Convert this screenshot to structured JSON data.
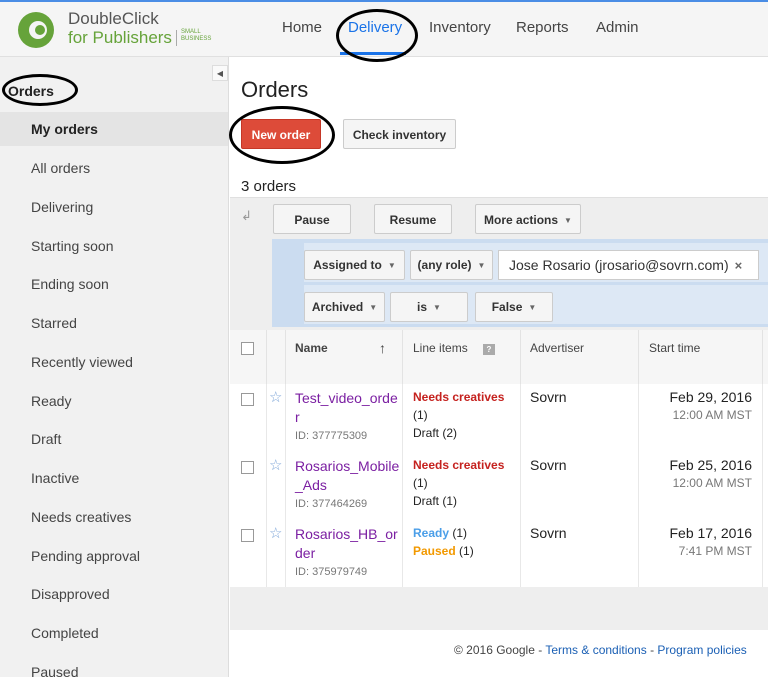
{
  "brand": {
    "line1": "DoubleClick",
    "line2": "for Publishers",
    "tag": "SMALL BUSINESS",
    "accent": "#66a33a"
  },
  "nav": {
    "items": [
      "Home",
      "Delivery",
      "Inventory",
      "Reports",
      "Admin"
    ],
    "active": "Delivery"
  },
  "sidebar": {
    "title": "Orders",
    "items": [
      "My orders",
      "All orders",
      "Delivering",
      "Starting soon",
      "Ending soon",
      "Starred",
      "Recently viewed",
      "Ready",
      "Draft",
      "Inactive",
      "Needs creatives",
      "Pending approval",
      "Disapproved",
      "Completed",
      "Paused"
    ],
    "selected": "My orders"
  },
  "main": {
    "title": "Orders",
    "new_order": "New order",
    "check_inventory": "Check inventory",
    "count": "3 orders",
    "actions": {
      "pause": "Pause",
      "resume": "Resume",
      "more": "More actions"
    },
    "filters": {
      "assigned_to": "Assigned to",
      "role": "(any role)",
      "user": "Jose Rosario (jrosario@sovrn.com)",
      "archived": "Archived",
      "operator": "is",
      "value": "False"
    },
    "columns": {
      "name": "Name",
      "line_items": "Line items",
      "advertiser": "Advertiser",
      "start_time": "Start time"
    },
    "rows": [
      {
        "name": "Test_video_order",
        "id": "ID: 377775309",
        "l1": "Needs creatives",
        "l1c": "(1)",
        "l2": "Draft (2)",
        "advertiser": "Sovrn",
        "date": "Feb 29, 2016",
        "time": "12:00 AM MST"
      },
      {
        "name": "Rosarios_Mobile_Ads",
        "id": "ID: 377464269",
        "l1": "Needs creatives",
        "l1c": "(1)",
        "l2": "Draft (1)",
        "advertiser": "Sovrn",
        "date": "Feb 25, 2016",
        "time": "12:00 AM MST"
      },
      {
        "name": "Rosarios_HB_order",
        "id": "ID: 375979749",
        "l1": "Ready",
        "l1c": "(1)",
        "l2": "Paused",
        "l2c": "(1)",
        "advertiser": "Sovrn",
        "date": "Feb 17, 2016",
        "time": "7:41 PM MST"
      }
    ]
  },
  "footer": {
    "copyright": "© 2016 Google - ",
    "terms": "Terms & conditions",
    "sep": " - ",
    "policies": "Program policies"
  }
}
